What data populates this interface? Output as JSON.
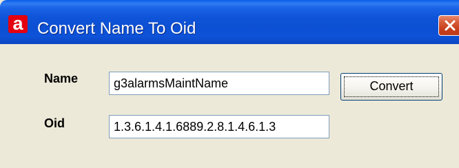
{
  "window": {
    "title": "Convert Name To Oid",
    "app_icon_letter": "a",
    "app_icon": "app-logo-icon",
    "close_icon": "close-icon"
  },
  "form": {
    "name_label": "Name",
    "name_value": "g3alarmsMaintName",
    "oid_label": "Oid",
    "oid_value": "1.3.6.1.4.1.6889.2.8.1.4.6.1.3",
    "convert_label": "Convert"
  },
  "colors": {
    "titlebar": "#0c4fd3",
    "close_button": "#d65a36",
    "dialog_background": "#ece9d8",
    "app_icon": "#e40010"
  }
}
